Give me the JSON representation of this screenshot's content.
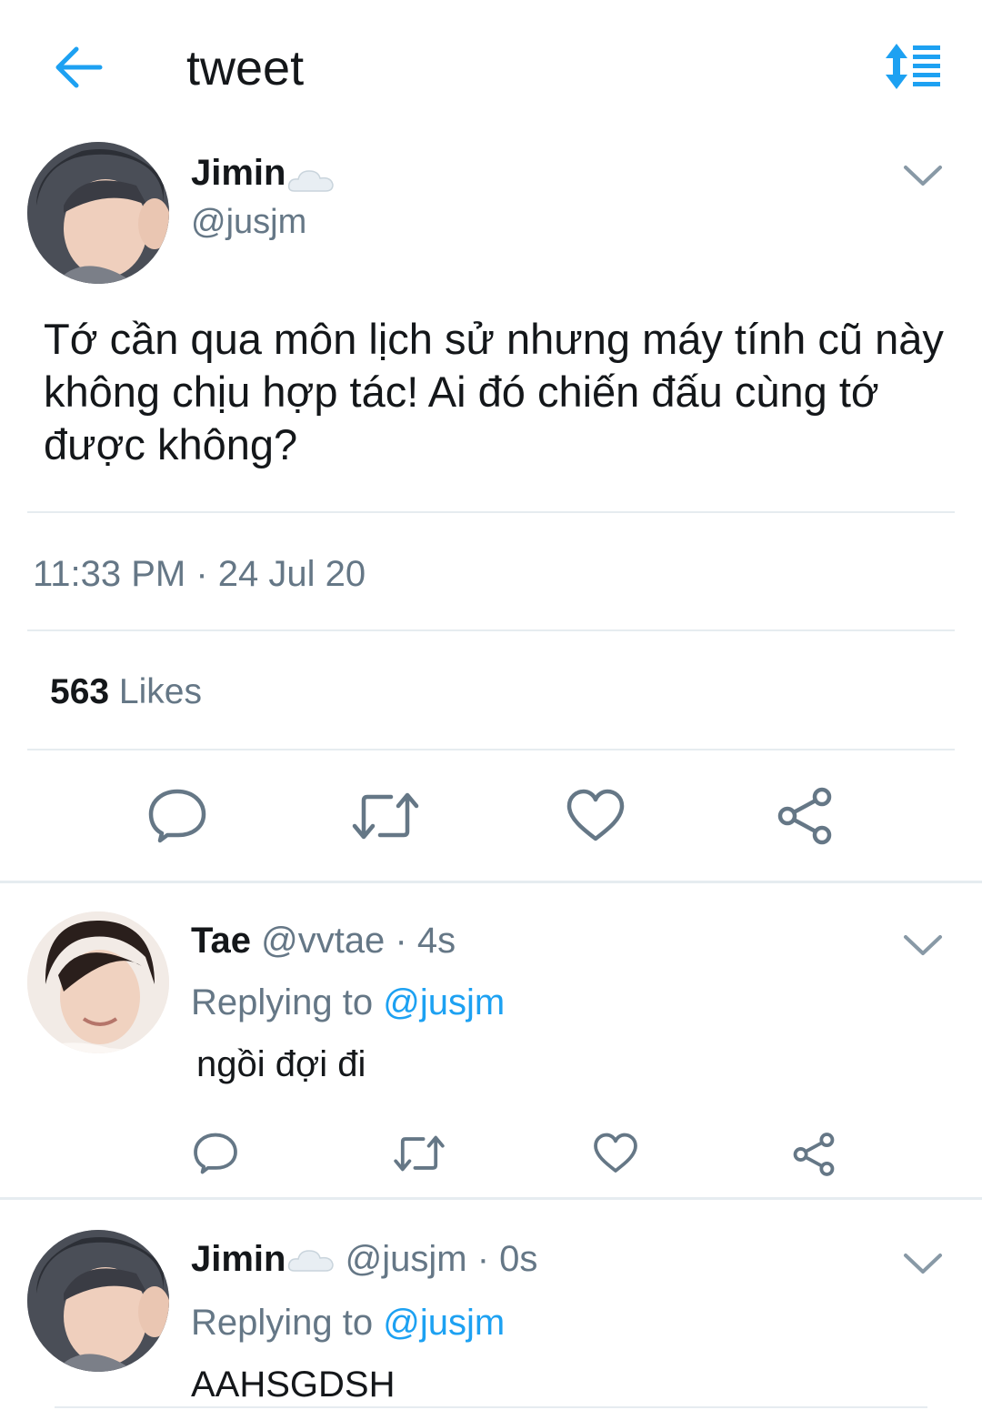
{
  "header": {
    "title": "tweet",
    "back_icon": "arrow-left-icon",
    "sort_icon": "sort-lines-icon",
    "accent": "#1da1f2"
  },
  "main_tweet": {
    "name": "Jimin",
    "name_emoji": "cloud-icon",
    "handle": "@jusjm",
    "text": "Tớ cần qua môn lịch sử nhưng máy tính cũ này không chịu hợp tác! Ai đó chiến đấu cùng tớ được không?",
    "timestamp": "11:33 PM · 24 Jul 20",
    "likes_count": "563",
    "likes_label": "Likes"
  },
  "replies": [
    {
      "name": "Tae",
      "handle": "@vvtae",
      "time": "· 4s",
      "replying_prefix": "Replying to",
      "replying_handle": "@jusjm",
      "text": "ngồi đợi đi"
    },
    {
      "name": "Jimin",
      "name_emoji": "cloud-icon",
      "handle": "@jusjm",
      "time": "· 0s",
      "replying_prefix": "Replying to",
      "replying_handle": "@jusjm",
      "text": "AAHSGDSH"
    }
  ],
  "colors": {
    "muted": "#657786",
    "link": "#1da1f2",
    "icon": "#657786",
    "divider": "#e6ecf0"
  }
}
